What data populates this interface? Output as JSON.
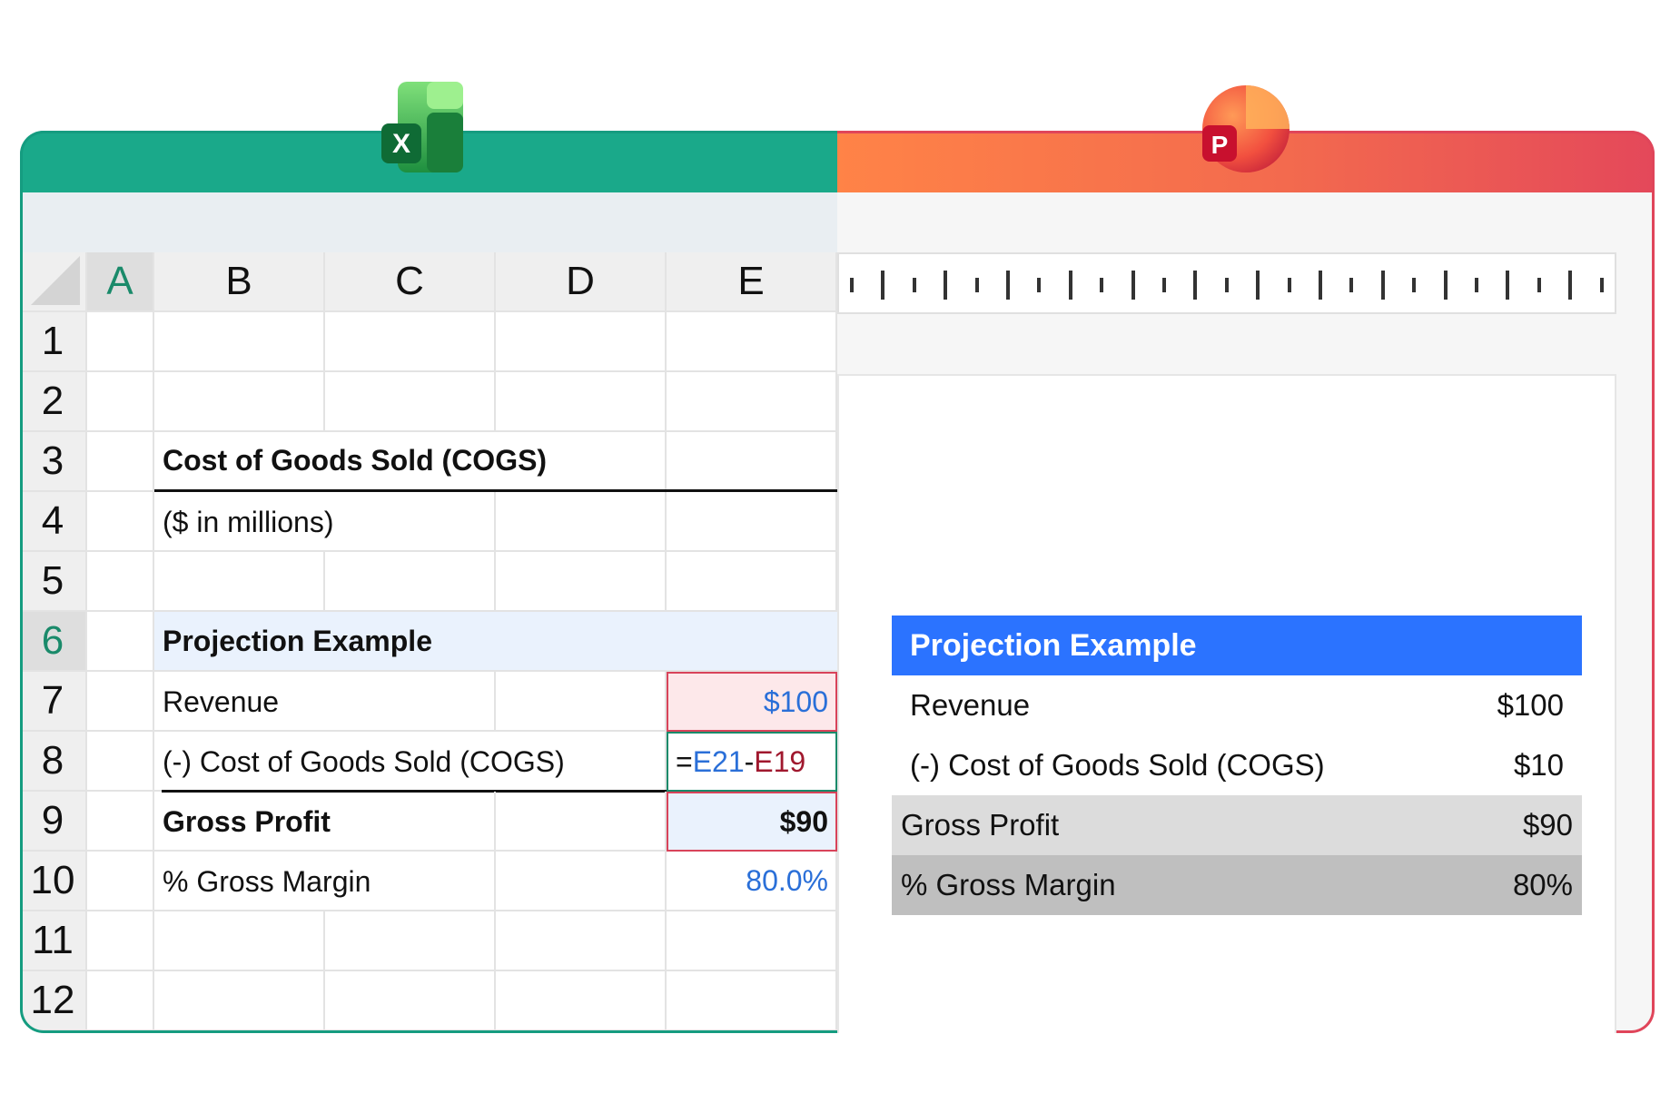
{
  "excel": {
    "app_icon": "excel-icon",
    "app_letter": "X",
    "accent": "#1aa98a",
    "columns": [
      "A",
      "B",
      "C",
      "D",
      "E"
    ],
    "rows": [
      "1",
      "2",
      "3",
      "4",
      "5",
      "6",
      "7",
      "8",
      "9",
      "10",
      "11",
      "12"
    ],
    "active_row": "6",
    "active_column": "A",
    "title": "Cost of Goods Sold (COGS)",
    "subtitle": "($ in millions)",
    "section": "Projection Example",
    "revenue_label": "Revenue",
    "revenue_value": "$100",
    "cogs_label": "(-) Cost of Goods Sold (COGS)",
    "cogs_formula": {
      "eq": "=",
      "ref1": "E21",
      "minus": "-",
      "ref2": "E19"
    },
    "gross_profit_label": "Gross Profit",
    "gross_profit_value": "$90",
    "margin_label": "% Gross Margin",
    "margin_value": "80.0%"
  },
  "powerpoint": {
    "app_icon": "powerpoint-icon",
    "app_letter": "P",
    "accent": "#e4485a",
    "table": {
      "header": "Projection Example",
      "header_color": "#2b73ff",
      "rows": [
        {
          "label": "Revenue",
          "value": "$100"
        },
        {
          "label": "(-) Cost of Goods Sold (COGS)",
          "value": "$10"
        },
        {
          "label": "Gross Profit",
          "value": "$90"
        },
        {
          "label": "% Gross Margin",
          "value": "80%"
        }
      ]
    }
  }
}
